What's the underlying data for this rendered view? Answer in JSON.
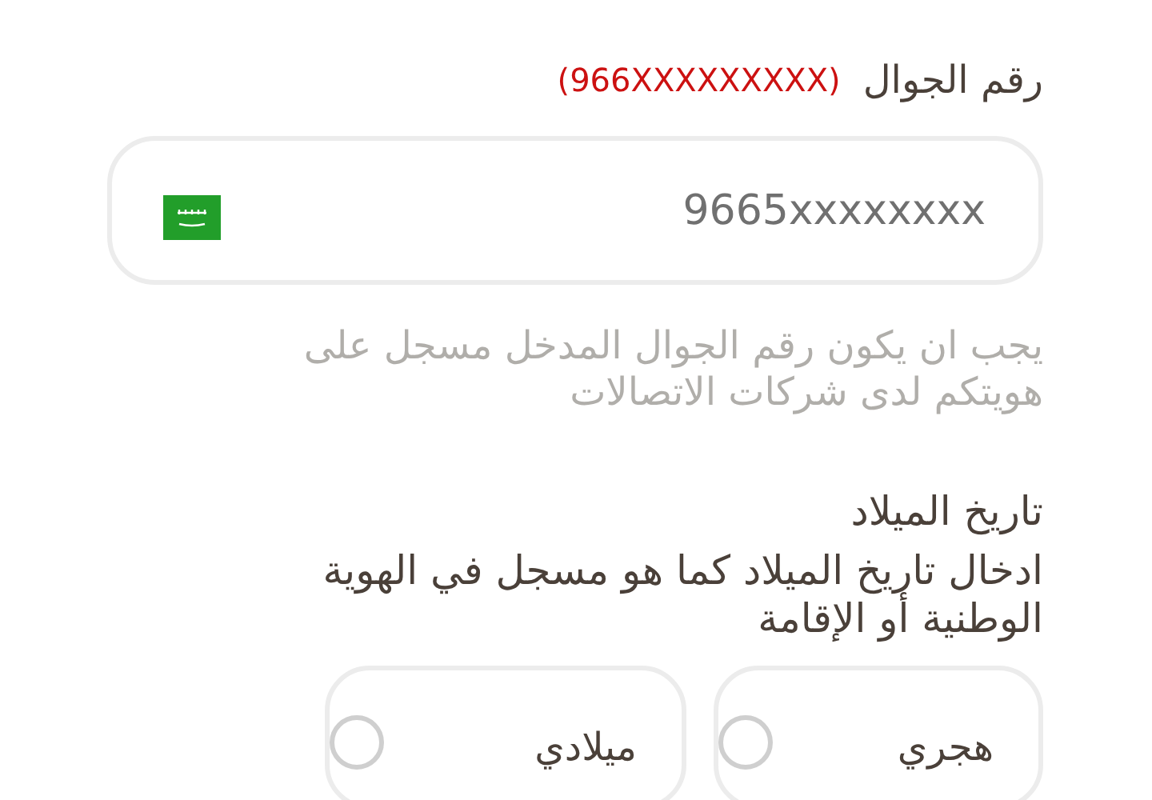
{
  "phone": {
    "label": "رقم الجوال",
    "format_hint": "(966XXXXXXXXX)",
    "value": "9665xxxxxxxx",
    "note": "يجب ان يكون رقم الجوال المدخل مسجل على هويتكم لدى شركات الاتصالات"
  },
  "birth_date": {
    "label": "تاريخ الميلاد",
    "description": "ادخال تاريخ الميلاد كما هو مسجل في الهوية الوطنية أو الإقامة",
    "options": [
      {
        "label": "هجري",
        "selected": false
      },
      {
        "label": "ميلادي",
        "selected": false
      }
    ]
  }
}
